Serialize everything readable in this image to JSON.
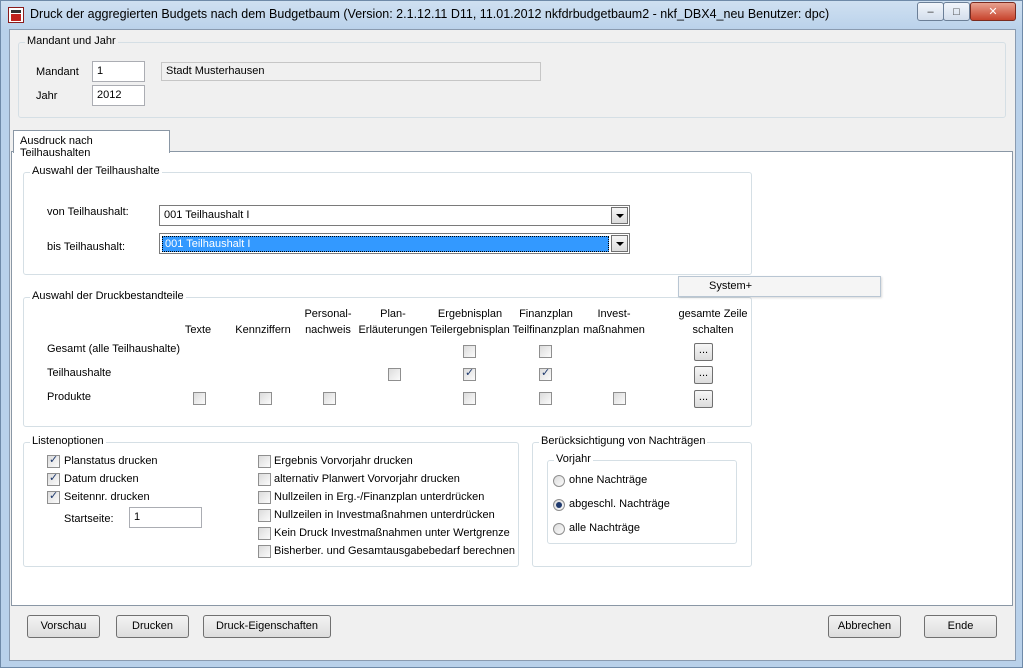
{
  "window": {
    "title": "Druck der aggregierten Budgets nach dem Budgetbaum (Version: 2.1.12.11 D11, 11.01.2012 nkfdrbudgetbaum2 - nkf_DBX4_neu  Benutzer: dpc)",
    "min_symbol": "–",
    "max_symbol": "□",
    "close_symbol": "✕"
  },
  "mandant_group": {
    "legend": "Mandant und Jahr",
    "mandant_label": "Mandant",
    "mandant_value": "1",
    "mandant_name": "Stadt Musterhausen",
    "jahr_label": "Jahr",
    "jahr_value": "2012"
  },
  "tabs": [
    {
      "label": "Ausdruck nach Teilhaushalten",
      "active": true
    }
  ],
  "auswahl_th": {
    "legend": "Auswahl der Teilhaushalte",
    "von_label": "von Teilhaushalt:",
    "von_value": "001  Teilhaushalt I",
    "bis_label": "bis Teilhaushalt:",
    "bis_value": "001  Teilhaushalt I"
  },
  "druckbestandteile": {
    "legend": "Auswahl der Druckbestandteile",
    "columns": [
      {
        "line1": "",
        "line2": "Texte"
      },
      {
        "line1": "",
        "line2": "Kennziffern"
      },
      {
        "line1": "Personal-",
        "line2": "nachweis"
      },
      {
        "line1": "Plan-",
        "line2": "Erläuterungen"
      },
      {
        "line1": "Ergebnisplan",
        "line2": "Teilergebnisplan"
      },
      {
        "line1": "Finanzplan",
        "line2": "Teilfinanzplan"
      },
      {
        "line1": "Invest-",
        "line2": "maßnahmen"
      },
      {
        "line1": "gesamte Zeile",
        "line2": "schalten"
      }
    ],
    "rows": [
      {
        "label": "Gesamt (alle Teilhaushalte)",
        "ergebnisplan": false,
        "finanzplan": false
      },
      {
        "label": "Teilhaushalte",
        "plan_erl": false,
        "ergebnisplan": true,
        "finanzplan": true
      },
      {
        "label": "Produkte",
        "texte": false,
        "kennziffern": false,
        "personal": false,
        "ergebnisplan": false,
        "finanzplan": false,
        "invest": false
      }
    ],
    "row_button_label": "..."
  },
  "popup": {
    "label": "System+"
  },
  "listenoptionen": {
    "legend": "Listenoptionen",
    "left": [
      {
        "label": "Planstatus drucken",
        "checked": true
      },
      {
        "label": "Datum drucken",
        "checked": true
      },
      {
        "label": "Seitennr. drucken",
        "checked": true
      }
    ],
    "startseite_label": "Startseite:",
    "startseite_value": "1",
    "right": [
      {
        "label": "Ergebnis Vorvorjahr drucken",
        "checked": false
      },
      {
        "label": "alternativ Planwert Vorvorjahr drucken",
        "checked": false
      },
      {
        "label": "Nullzeilen in Erg.-/Finanzplan unterdrücken",
        "checked": false
      },
      {
        "label": "Nullzeilen in Investmaßnahmen unterdrücken",
        "checked": false
      },
      {
        "label": "Kein Druck Investmaßnahmen unter Wertgrenze",
        "checked": false
      },
      {
        "label": "Bisherber. und Gesamtausgabebedarf berechnen",
        "checked": false
      }
    ]
  },
  "nachtraege": {
    "legend": "Berücksichtigung von Nachträgen",
    "inner_legend": "Vorjahr",
    "options": [
      {
        "label": "ohne Nachträge",
        "checked": false
      },
      {
        "label": "abgeschl. Nachträge",
        "checked": true
      },
      {
        "label": "alle Nachträge",
        "checked": false
      }
    ]
  },
  "buttons": {
    "vorschau": "Vorschau",
    "drucken": "Drucken",
    "druck_eigenschaften": "Druck-Eigenschaften",
    "abbrechen": "Abbrechen",
    "ende": "Ende"
  }
}
